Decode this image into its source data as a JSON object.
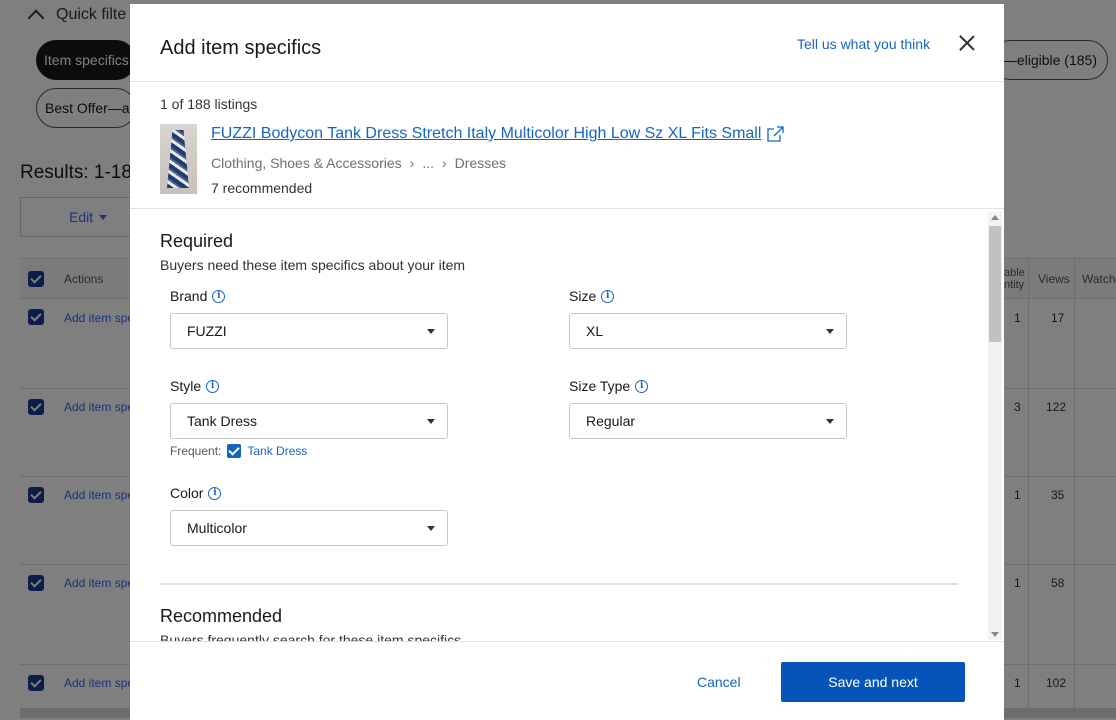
{
  "background": {
    "quick_filters_label": "Quick filte",
    "filter_pills": [
      "Item specifics",
      "Best Offer—ac",
      "—eligible (185)"
    ],
    "results_text": "Results: 1-18",
    "edit_label": "Edit",
    "table_headers": [
      "Actions",
      "able ntity",
      "Views",
      "Watch"
    ],
    "rows": [
      {
        "action": "Add item spe",
        "qty": "1",
        "views": "17"
      },
      {
        "action": "Add item spe",
        "qty": "3",
        "views": "122"
      },
      {
        "action": "Add item spe",
        "qty": "1",
        "views": "35"
      },
      {
        "action": "Add item spe",
        "qty": "1",
        "views": "58"
      },
      {
        "action": "Add item spe",
        "qty": "1",
        "views": "102"
      }
    ]
  },
  "modal": {
    "title": "Add item specifics",
    "feedback_link": "Tell us what you think",
    "listing_count": "1 of 188 listings",
    "listing": {
      "title": "FUZZI Bodycon Tank Dress Stretch Italy Multicolor High Low Sz XL Fits Small",
      "category": [
        "Clothing, Shoes & Accessories",
        "›",
        "...",
        "›",
        "Dresses"
      ],
      "recommended_count": "7 recommended"
    },
    "required": {
      "title": "Required",
      "subtitle": "Buyers need these item specifics about your item",
      "fields": {
        "brand": {
          "label": "Brand",
          "value": "FUZZI"
        },
        "size": {
          "label": "Size",
          "value": "XL"
        },
        "style": {
          "label": "Style",
          "value": "Tank Dress"
        },
        "size_type": {
          "label": "Size Type",
          "value": "Regular"
        },
        "color": {
          "label": "Color",
          "value": "Multicolor"
        }
      },
      "frequent_label": "Frequent:",
      "frequent_value": "Tank Dress"
    },
    "recommended": {
      "title": "Recommended",
      "subtitle": "Buyers frequently search for these item specifics"
    },
    "cancel_label": "Cancel",
    "save_label": "Save and next",
    "accent_color": "#0654ba",
    "link_color": "#1565c0"
  }
}
